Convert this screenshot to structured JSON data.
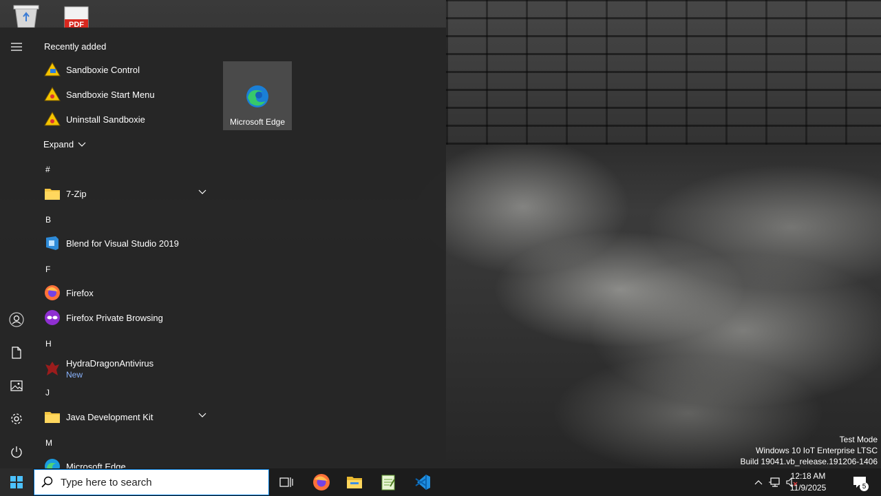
{
  "desktop": {
    "icons": [
      {
        "name": "recycle-bin-icon"
      },
      {
        "name": "pdf-file-icon",
        "label": "PDF"
      }
    ],
    "watermark": {
      "line1": "Test Mode",
      "line2": "Windows 10 IoT Enterprise LTSC",
      "line3": "Build 19041.vb_release.191206-1406"
    }
  },
  "start_menu": {
    "recently_added_title": "Recently added",
    "recent": [
      {
        "label": "Sandboxie Control",
        "icon": "sandboxie-control-icon"
      },
      {
        "label": "Sandboxie Start Menu",
        "icon": "sandboxie-icon"
      },
      {
        "label": "Uninstall Sandboxie",
        "icon": "sandboxie-icon"
      }
    ],
    "expand_label": "Expand",
    "letters": {
      "hash": "#",
      "b": "B",
      "f": "F",
      "h": "H",
      "j": "J",
      "m": "M"
    },
    "apps": {
      "seven_zip": "7-Zip",
      "blend": "Blend for Visual Studio 2019",
      "firefox": "Firefox",
      "firefox_private": "Firefox Private Browsing",
      "hydra": "HydraDragonAntivirus",
      "hydra_badge": "New",
      "jdk": "Java Development Kit",
      "edge": "Microsoft Edge"
    },
    "tiles": [
      {
        "label": "Microsoft Edge",
        "icon": "edge-icon"
      }
    ],
    "rail": [
      "menu-icon",
      "user-icon",
      "documents-icon",
      "pictures-icon",
      "settings-icon",
      "power-icon"
    ]
  },
  "taskbar": {
    "search_placeholder": "Type here to search",
    "pinned": [
      "task-view-icon",
      "firefox-icon",
      "file-explorer-icon",
      "notepad-plus-plus-icon",
      "vscode-icon"
    ],
    "clock_time": "12:18 AM",
    "clock_date": "11/9/2025",
    "notification_count": "5"
  },
  "colors": {
    "accent": "#0078d7",
    "menu_bg": "#262626",
    "taskbar_bg": "#1c1c1c"
  }
}
